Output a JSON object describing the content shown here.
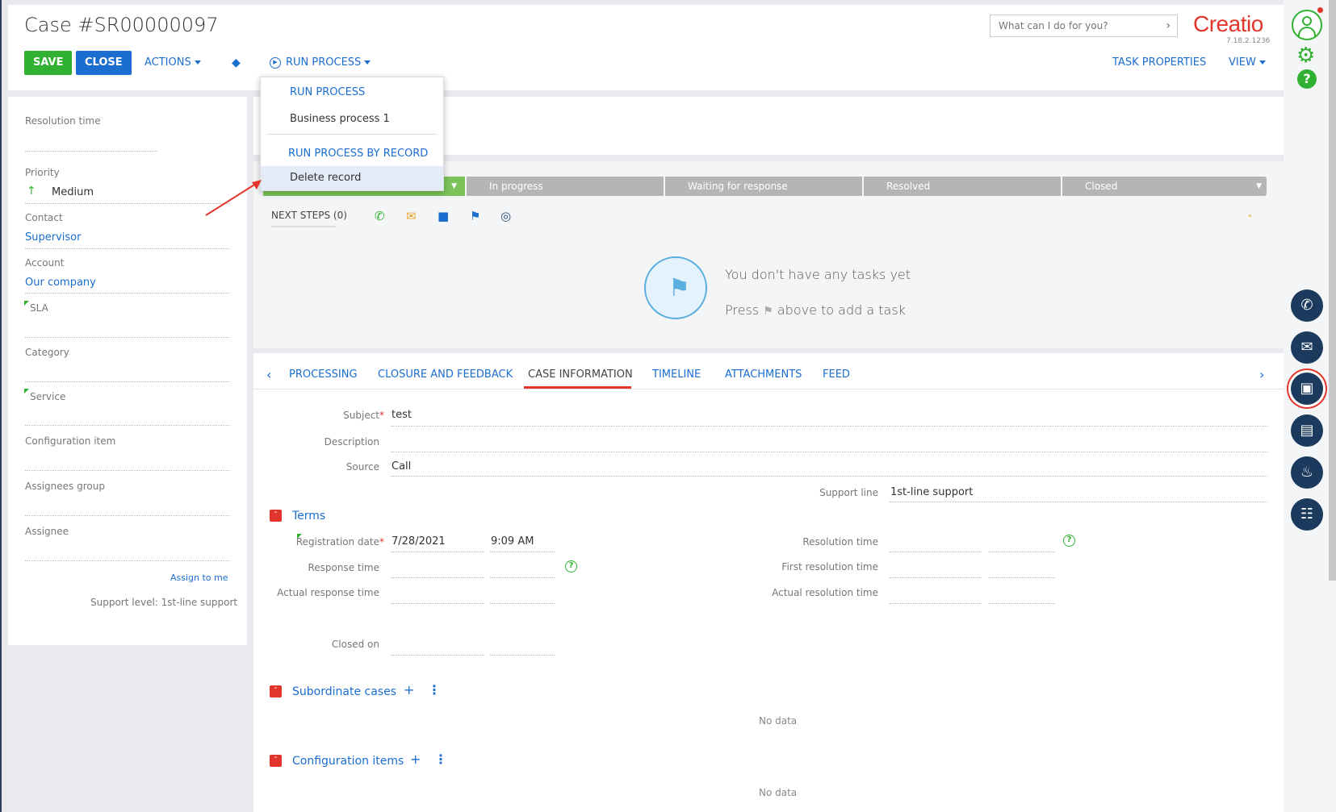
{
  "header": {
    "title": "Case #SR00000097",
    "save_label": "SAVE",
    "close_label": "CLOSE",
    "actions_label": "ACTIONS",
    "run_process_label": "RUN PROCESS",
    "task_properties_label": "TASK PROPERTIES",
    "view_label": "VIEW",
    "search_placeholder": "What can I do for you?",
    "logo_text": "Creatio",
    "version": "7.18.2.1236"
  },
  "dropdown": {
    "items": [
      {
        "label": "RUN PROCESS",
        "type": "header"
      },
      {
        "label": "Business process 1",
        "type": "item"
      },
      {
        "label": "RUN PROCESS BY RECORD",
        "type": "header"
      },
      {
        "label": "Delete record",
        "type": "item",
        "hover": true
      }
    ]
  },
  "left_panel": {
    "resolution_time_label": "Resolution time",
    "priority_label": "Priority",
    "priority_value": "Medium",
    "contact_label": "Contact",
    "contact_value": "Supervisor",
    "account_label": "Account",
    "account_value": "Our company",
    "sla_label": "SLA",
    "category_label": "Category",
    "service_label": "Service",
    "config_item_label": "Configuration item",
    "assignees_group_label": "Assignees group",
    "assignee_label": "Assignee",
    "assign_to_me": "Assign to me",
    "support_level": "Support level: 1st-line support"
  },
  "stages": [
    "In progress",
    "Waiting for response",
    "Resolved",
    "Closed"
  ],
  "next_steps": {
    "label": "NEXT STEPS (0)",
    "empty_title": "You don't have any tasks yet",
    "empty_hint_prefix": "Press",
    "empty_hint_suffix": "above to add a task"
  },
  "tabs": [
    "PROCESSING",
    "CLOSURE AND FEEDBACK",
    "CASE INFORMATION",
    "TIMELINE",
    "ATTACHMENTS",
    "FEED"
  ],
  "active_tab": "CASE INFORMATION",
  "case_info": {
    "subject_label": "Subject",
    "subject_value": "test",
    "description_label": "Description",
    "source_label": "Source",
    "source_value": "Call",
    "support_line_label": "Support line",
    "support_line_value": "1st-line support"
  },
  "terms": {
    "title": "Terms",
    "registration_date_label": "Registration date",
    "registration_date": "7/28/2021",
    "registration_time": "9:09 AM",
    "response_time_label": "Response time",
    "actual_response_time_label": "Actual response time",
    "closed_on_label": "Closed on",
    "resolution_time_label": "Resolution time",
    "first_resolution_time_label": "First resolution time",
    "actual_resolution_time_label": "Actual resolution time"
  },
  "subordinate_cases": {
    "title": "Subordinate cases",
    "no_data": "No data"
  },
  "configuration_items": {
    "title": "Configuration items",
    "no_data": "No data"
  },
  "colors": {
    "accent": "#1b6dd0",
    "save": "#31b131",
    "brand": "#e2352b",
    "stage_active": "#7cc35a"
  }
}
